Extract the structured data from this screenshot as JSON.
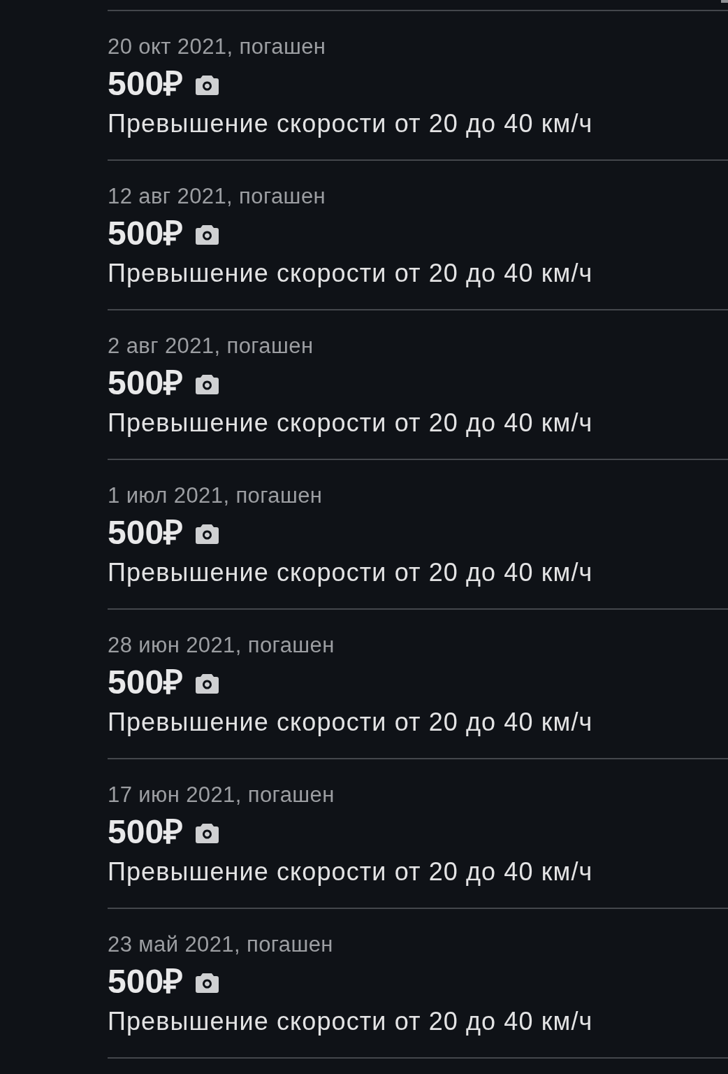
{
  "fines": [
    {
      "date": "20 окт 2021, погашен",
      "amount": "500₽",
      "photo": true,
      "description": "Превышение скорости от 20 до 40 км/ч"
    },
    {
      "date": "12 авг 2021, погашен",
      "amount": "500₽",
      "photo": true,
      "description": "Превышение скорости от 20 до 40 км/ч"
    },
    {
      "date": "2 авг 2021, погашен",
      "amount": "500₽",
      "photo": true,
      "description": "Превышение скорости от 20 до 40 км/ч"
    },
    {
      "date": "1 июл 2021, погашен",
      "amount": "500₽",
      "photo": true,
      "description": "Превышение скорости от 20 до 40 км/ч"
    },
    {
      "date": "28 июн 2021, погашен",
      "amount": "500₽",
      "photo": true,
      "description": "Превышение скорости от 20 до 40 км/ч"
    },
    {
      "date": "17 июн 2021, погашен",
      "amount": "500₽",
      "photo": true,
      "description": "Превышение скорости от 20 до 40 км/ч"
    },
    {
      "date": "23 май 2021, погашен",
      "amount": "500₽",
      "photo": true,
      "description": "Превышение скорости от 20 до 40 км/ч"
    }
  ]
}
